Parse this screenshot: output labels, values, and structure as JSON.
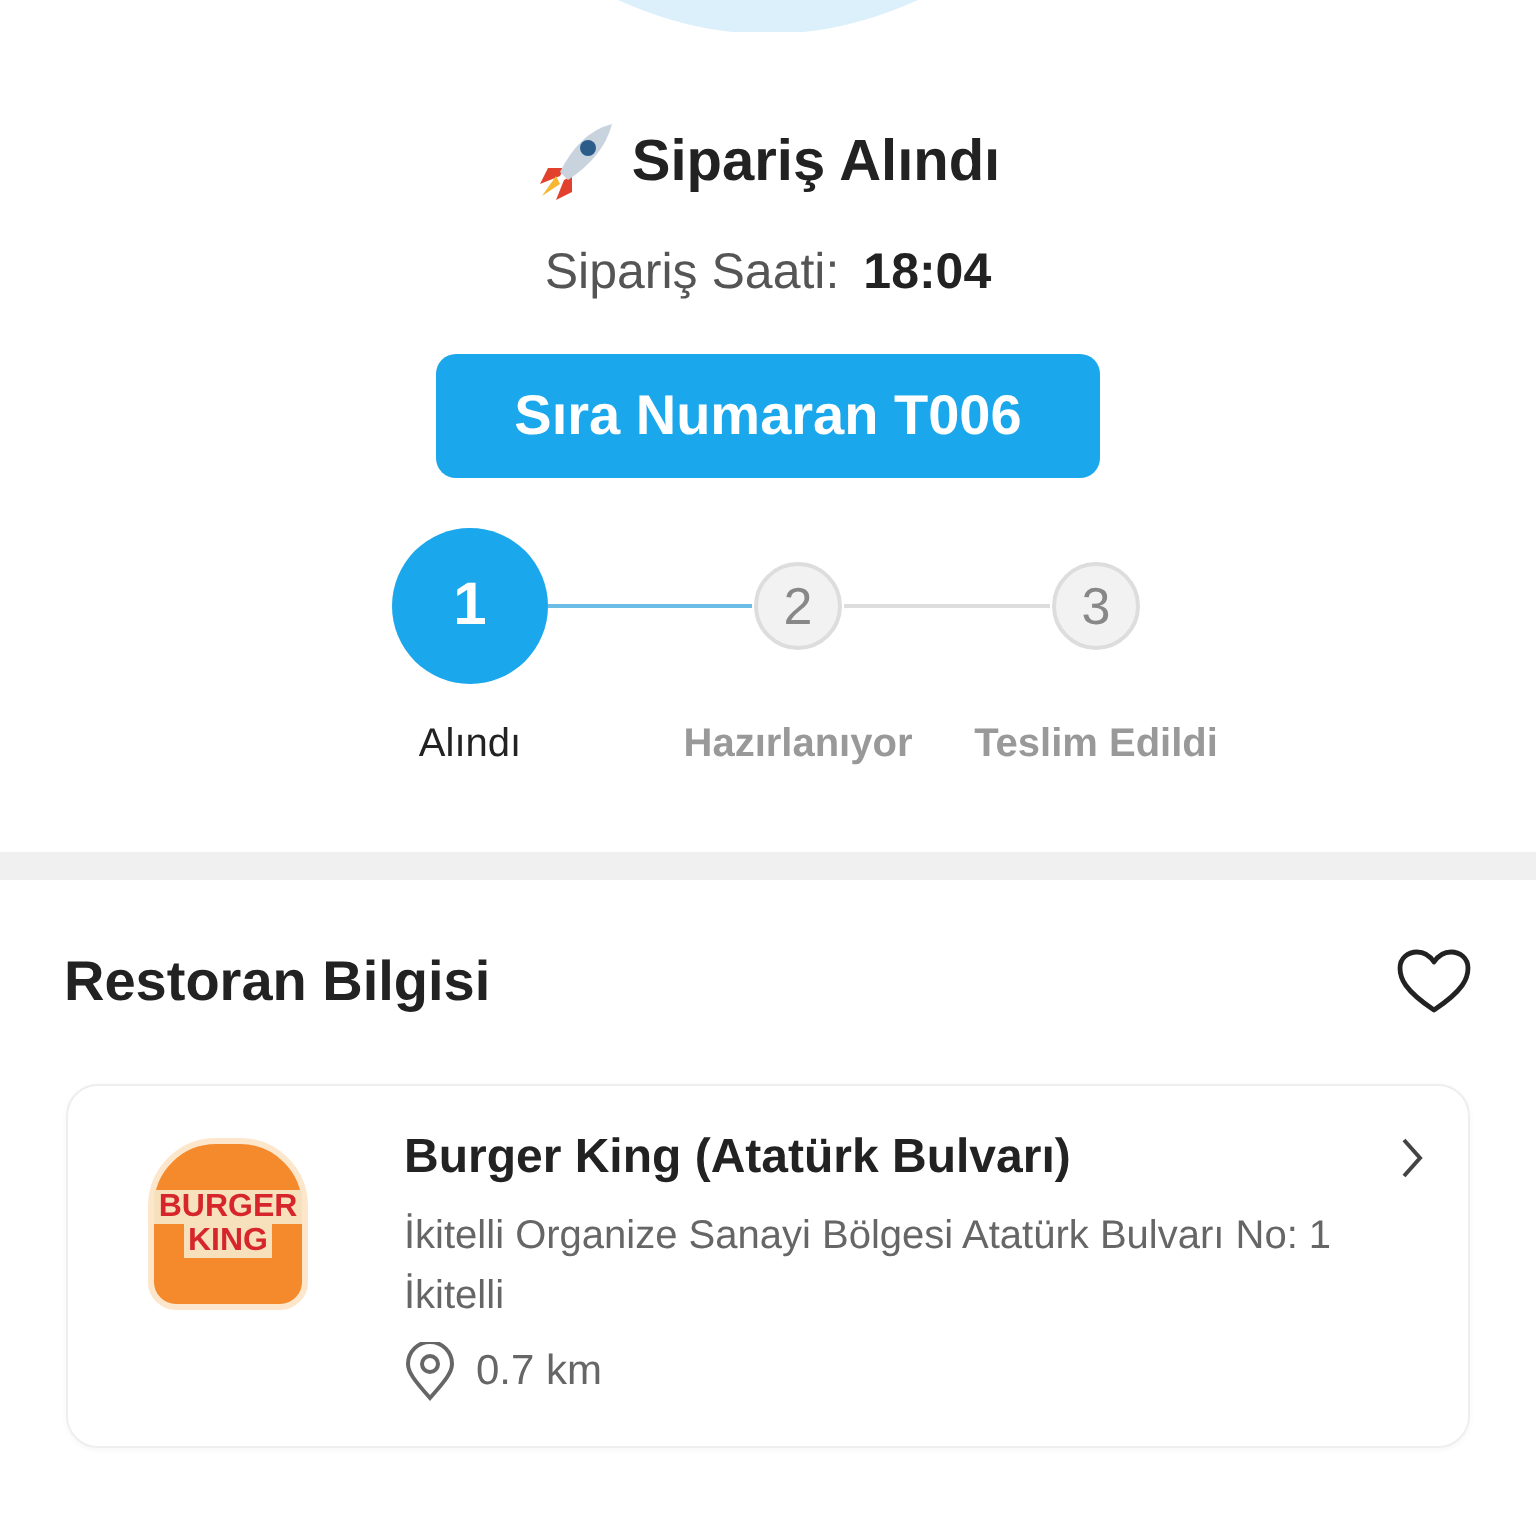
{
  "order_status": {
    "title": "Sipariş Alındı",
    "time_label": "Sipariş Saati:",
    "time": "18:04"
  },
  "queue_button": {
    "label": "Sıra Numaran T006"
  },
  "steps": [
    {
      "number": "1",
      "label": "Alındı",
      "active": true
    },
    {
      "number": "2",
      "label": "Hazırlanıyor",
      "active": false
    },
    {
      "number": "3",
      "label": "Teslim Edildi",
      "active": false
    }
  ],
  "restaurant_section": {
    "title": "Restoran Bilgisi",
    "favorite": false
  },
  "restaurant": {
    "logo_lines": [
      "BURGER",
      "KING"
    ],
    "name": "Burger King (Atatürk Bulvarı)",
    "address": "İkitelli Organize Sanayi Bölgesi Atatürk Bulvarı No: 1 İkitelli",
    "distance": "0.7 km"
  }
}
